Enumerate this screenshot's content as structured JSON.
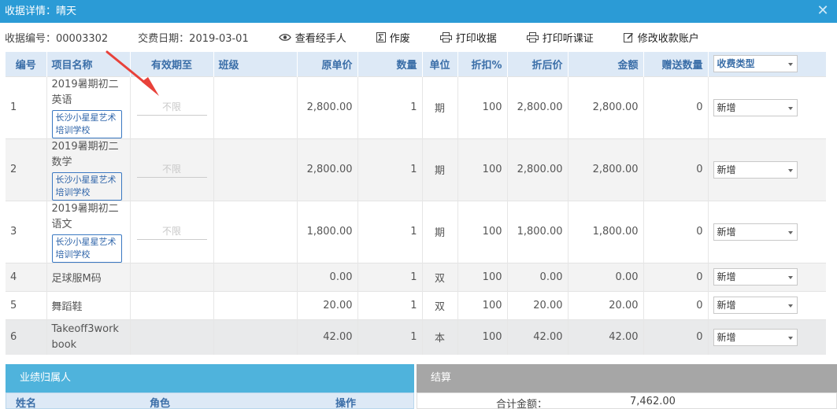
{
  "title": "收据详情：晴天",
  "toolbar": {
    "receipt_no": "收据编号：00003302",
    "pay_date": "交费日期：2019-03-01",
    "view_handler": "查看经手人",
    "void": "作废",
    "print_receipt": "打印收据",
    "print_trial": "打印听课证",
    "edit_account": "修改收款账户"
  },
  "table": {
    "headers": {
      "no": "编号",
      "name": "项目名称",
      "valid": "有效期至",
      "class": "班级",
      "orig_price": "原单价",
      "qty": "数量",
      "unit": "单位",
      "discount": "折扣%",
      "disc_price": "折后价",
      "amount": "金额",
      "gift_qty": "赠送数量",
      "fee_type": "收费类型"
    },
    "rows": [
      {
        "no": "1",
        "name": "2019暑期初二英语",
        "school": "长沙小星星艺术培训学校",
        "valid": "不限",
        "class": "",
        "orig_price": "2,800.00",
        "qty": "1",
        "unit": "期",
        "discount": "100",
        "disc_price": "2,800.00",
        "amount": "2,800.00",
        "gift_qty": "0",
        "fee_type": "新增"
      },
      {
        "no": "2",
        "name": "2019暑期初二数学",
        "school": "长沙小星星艺术培训学校",
        "valid": "不限",
        "class": "",
        "orig_price": "2,800.00",
        "qty": "1",
        "unit": "期",
        "discount": "100",
        "disc_price": "2,800.00",
        "amount": "2,800.00",
        "gift_qty": "0",
        "fee_type": "新增"
      },
      {
        "no": "3",
        "name": "2019暑期初二语文",
        "school": "长沙小星星艺术培训学校",
        "valid": "不限",
        "class": "",
        "orig_price": "1,800.00",
        "qty": "1",
        "unit": "期",
        "discount": "100",
        "disc_price": "1,800.00",
        "amount": "1,800.00",
        "gift_qty": "0",
        "fee_type": "新增"
      },
      {
        "no": "4",
        "name": "足球服M码",
        "orig_price": "0.00",
        "qty": "1",
        "unit": "双",
        "discount": "100",
        "disc_price": "0.00",
        "amount": "0.00",
        "gift_qty": "0",
        "fee_type": "新增"
      },
      {
        "no": "5",
        "name": "舞蹈鞋",
        "orig_price": "20.00",
        "qty": "1",
        "unit": "双",
        "discount": "100",
        "disc_price": "20.00",
        "amount": "20.00",
        "gift_qty": "0",
        "fee_type": "新增"
      },
      {
        "no": "6",
        "name": "Takeoff3workbook",
        "orig_price": "42.00",
        "qty": "1",
        "unit": "本",
        "discount": "100",
        "disc_price": "42.00",
        "amount": "42.00",
        "gift_qty": "0",
        "fee_type": "新增"
      }
    ]
  },
  "performance": {
    "title": "业绩归属人",
    "col_name": "姓名",
    "col_role": "角色",
    "col_action": "操作"
  },
  "settlement": {
    "title": "结算",
    "total_label": "合计金额：",
    "total_value": "7,462.00"
  },
  "colors": {
    "titlebar": "#2b9bd6",
    "header_bg": "#dde9f6",
    "header_text": "#3a6ea8",
    "arrow": "#e8413a"
  }
}
